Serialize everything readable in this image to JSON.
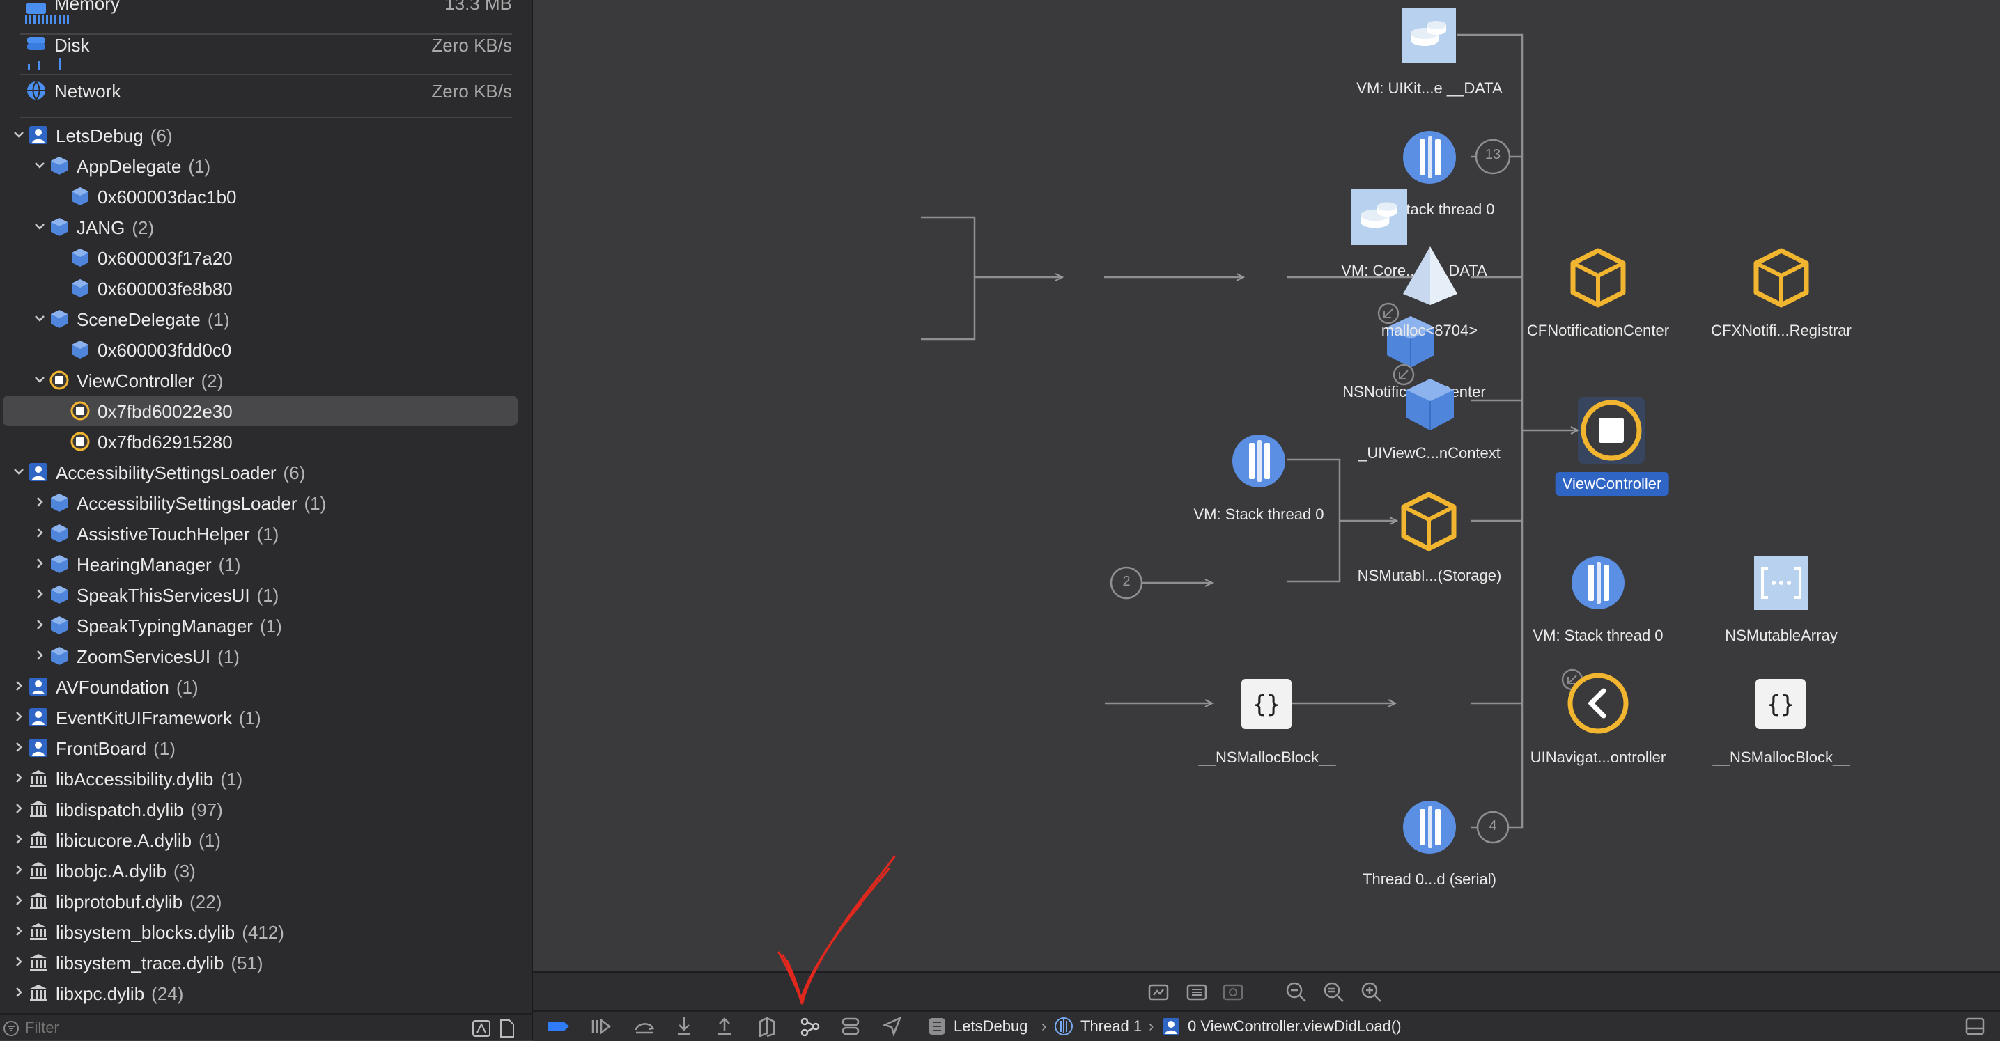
{
  "gauges": [
    {
      "label": "Memory",
      "value": "13.3 MB",
      "icon": "memory-icon"
    },
    {
      "label": "Disk",
      "value": "Zero KB/s",
      "icon": "disk-icon"
    },
    {
      "label": "Network",
      "value": "Zero KB/s",
      "icon": "network-icon"
    }
  ],
  "tree": [
    {
      "label": "LetsDebug",
      "count": "(6)",
      "icon": "person-module-icon",
      "expanded": true
    },
    {
      "label": "AppDelegate",
      "count": "(1)",
      "icon": "class-cube-icon",
      "expanded": true
    },
    {
      "label": "0x600003dac1b0",
      "count": "",
      "icon": "instance-cube-icon"
    },
    {
      "label": "JANG",
      "count": "(2)",
      "icon": "class-cube-icon",
      "expanded": true
    },
    {
      "label": "0x600003f17a20",
      "count": "",
      "icon": "instance-cube-icon"
    },
    {
      "label": "0x600003fe8b80",
      "count": "",
      "icon": "instance-cube-icon"
    },
    {
      "label": "SceneDelegate",
      "count": "(1)",
      "icon": "class-cube-icon",
      "expanded": true
    },
    {
      "label": "0x600003fdd0c0",
      "count": "",
      "icon": "instance-cube-icon"
    },
    {
      "label": "ViewController",
      "count": "(2)",
      "icon": "viewcontroller-icon",
      "expanded": true
    },
    {
      "label": "0x7fbd60022e30",
      "count": "",
      "icon": "viewcontroller-icon",
      "selected": true
    },
    {
      "label": "0x7fbd62915280",
      "count": "",
      "icon": "viewcontroller-icon"
    },
    {
      "label": "AccessibilitySettingsLoader",
      "count": "(6)",
      "icon": "person-module-icon",
      "expanded": true
    },
    {
      "label": "AccessibilitySettingsLoader",
      "count": "(1)",
      "icon": "class-cube-icon"
    },
    {
      "label": "AssistiveTouchHelper",
      "count": "(1)",
      "icon": "class-cube-icon"
    },
    {
      "label": "HearingManager",
      "count": "(1)",
      "icon": "class-cube-icon"
    },
    {
      "label": "SpeakThisServicesUI",
      "count": "(1)",
      "icon": "class-cube-icon"
    },
    {
      "label": "SpeakTypingManager",
      "count": "(1)",
      "icon": "class-cube-icon"
    },
    {
      "label": "ZoomServicesUI",
      "count": "(1)",
      "icon": "class-cube-icon"
    },
    {
      "label": "AVFoundation",
      "count": "(1)",
      "icon": "person-module-icon"
    },
    {
      "label": "EventKitUIFramework",
      "count": "(1)",
      "icon": "person-module-icon"
    },
    {
      "label": "FrontBoard",
      "count": "(1)",
      "icon": "person-module-icon"
    },
    {
      "label": "libAccessibility.dylib",
      "count": "(1)",
      "icon": "library-icon"
    },
    {
      "label": "libdispatch.dylib",
      "count": "(97)",
      "icon": "library-icon"
    },
    {
      "label": "libicucore.A.dylib",
      "count": "(1)",
      "icon": "library-icon"
    },
    {
      "label": "libobjc.A.dylib",
      "count": "(3)",
      "icon": "library-icon"
    },
    {
      "label": "libprotobuf.dylib",
      "count": "(22)",
      "icon": "library-icon"
    },
    {
      "label": "libsystem_blocks.dylib",
      "count": "(412)",
      "icon": "library-icon"
    },
    {
      "label": "libsystem_trace.dylib",
      "count": "(51)",
      "icon": "library-icon"
    },
    {
      "label": "libxpc.dylib",
      "count": "(24)",
      "icon": "library-icon"
    }
  ],
  "filter": {
    "placeholder": "Filter"
  },
  "graph": {
    "nodes": {
      "vm_uikit": "VM: UIKit...e __DATA",
      "vm_stack_13": "VM: Stack thread 0",
      "badge_13": "13",
      "vm_core": "VM: Core...n __DATA",
      "nsnotificationcenter": "NSNotificationCenter",
      "cfnotificationcenter": "CFNotificationCenter",
      "cfxnotifi_registrar": "CFXNotifi...Registrar",
      "malloc": "malloc<8704>",
      "uiviewc_context": "_UIViewC...nContext",
      "viewcontroller": "ViewController",
      "vm_stack_a": "VM: Stack thread 0",
      "nsmutable_storage": "NSMutabl...(Storage)",
      "vm_stack_b": "VM: Stack thread 0",
      "badge_2": "2",
      "nsmutablearray": "NSMutableArray",
      "uinavigat": "UINavigat...ontroller",
      "nsmallocblock_1": "__NSMallocBlock__",
      "nsmallocblock_2": "__NSMallocBlock__",
      "thread_serial": "Thread 0...d  (serial)",
      "badge_4": "4"
    }
  },
  "debugbar": {
    "app": "LetsDebug",
    "thread": "Thread 1",
    "frame": "0 ViewController.viewDidLoad()"
  },
  "colors": {
    "accent_blue": "#2f66c6",
    "cube_yellow": "#f1b530",
    "cube_blue": "#5b8fe3",
    "annotation_red": "#e0281e"
  }
}
